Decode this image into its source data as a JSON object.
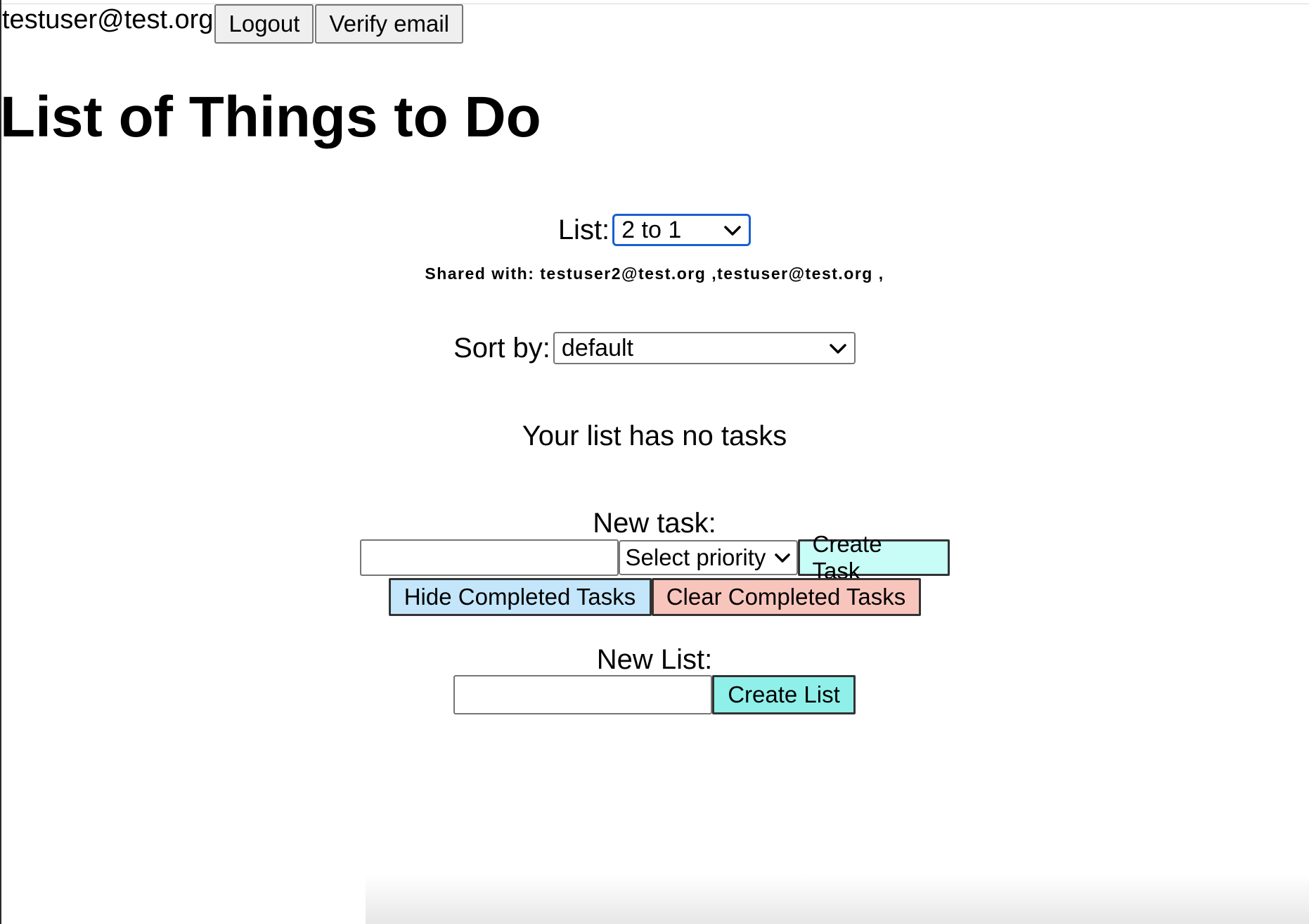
{
  "header": {
    "user_email": "testuser@test.org",
    "logout_label": "Logout",
    "verify_label": "Verify email"
  },
  "page": {
    "title": "List of Things to Do"
  },
  "list_selector": {
    "label": "List:",
    "selected": "2 to 1"
  },
  "shared": {
    "text": "Shared with: testuser2@test.org ,testuser@test.org ,"
  },
  "sort": {
    "label": "Sort by:",
    "selected": "default"
  },
  "tasks": {
    "empty_message": "Your list has no tasks"
  },
  "new_task": {
    "label": "New task:",
    "input_value": "",
    "priority_placeholder": "Select priority",
    "create_label": "Create Task",
    "hide_completed_label": "Hide Completed Tasks",
    "clear_completed_label": "Clear Completed Tasks"
  },
  "new_list": {
    "label": "New List:",
    "input_value": "",
    "create_label": "Create List"
  },
  "colors": {
    "create_task_bg": "#c8fcf6",
    "hide_completed_bg": "#c3e6fb",
    "clear_completed_bg": "#f8c5bd",
    "create_list_bg": "#8ff0ea",
    "focus_ring": "#1a5fd0"
  }
}
